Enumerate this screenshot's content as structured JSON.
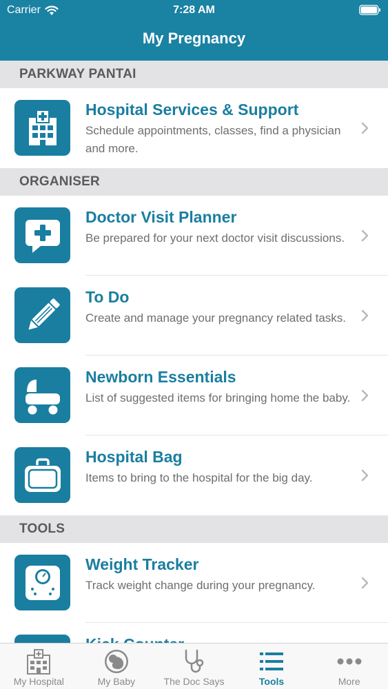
{
  "status_bar": {
    "carrier": "Carrier",
    "time": "7:28 AM"
  },
  "nav": {
    "title": "My Pregnancy"
  },
  "sections": [
    {
      "header": "PARKWAY PANTAI",
      "rows": [
        {
          "title": "Hospital Services & Support",
          "subtitle": "Schedule appointments, classes, find a physician and more.",
          "icon": "hospital-icon"
        }
      ]
    },
    {
      "header": "ORGANISER",
      "rows": [
        {
          "title": "Doctor Visit Planner",
          "subtitle": "Be prepared for your next doctor visit discussions.",
          "icon": "chat-plus-icon"
        },
        {
          "title": "To Do",
          "subtitle": "Create and manage your pregnancy related tasks.",
          "icon": "pencil-icon"
        },
        {
          "title": "Newborn Essentials",
          "subtitle": "List of suggested items for bringing home the baby.",
          "icon": "stroller-icon"
        },
        {
          "title": "Hospital Bag",
          "subtitle": "Items to bring to the hospital for the big day.",
          "icon": "bag-icon"
        }
      ]
    },
    {
      "header": "TOOLS",
      "rows": [
        {
          "title": "Weight Tracker",
          "subtitle": "Track weight change during your pregnancy.",
          "icon": "scale-icon"
        },
        {
          "title": "Kick Counter",
          "subtitle": "",
          "icon": "footprint-icon"
        }
      ]
    }
  ],
  "tabs": [
    {
      "label": "My Hospital",
      "icon": "hospital-tab-icon",
      "active": false
    },
    {
      "label": "My Baby",
      "icon": "baby-tab-icon",
      "active": false
    },
    {
      "label": "The Doc Says",
      "icon": "stethoscope-tab-icon",
      "active": false
    },
    {
      "label": "Tools",
      "icon": "list-tab-icon",
      "active": true
    },
    {
      "label": "More",
      "icon": "more-tab-icon",
      "active": false
    }
  ],
  "colors": {
    "primary": "#1a82a3",
    "accent": "#1a7ea0",
    "section_bg": "#e3e3e5",
    "tab_inactive": "#8a8a8a"
  }
}
